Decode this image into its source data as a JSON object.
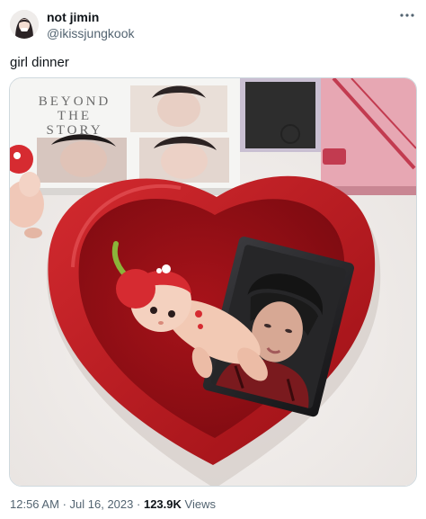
{
  "author": {
    "display_name": "not jimin",
    "handle": "@ikissjungkook"
  },
  "tweet": {
    "text": "girl dinner"
  },
  "photo": {
    "book_title_line1": "BEYOND",
    "book_title_line2": "THE",
    "book_title_line3": "STORY",
    "colors": {
      "bowl": "#b3151c",
      "bowl_inner": "#8f0c12",
      "background": "#f1eeec",
      "pink_box": "#e7a7b3"
    }
  },
  "meta": {
    "time": "12:56 AM",
    "separator1": "·",
    "date": "Jul 16, 2023",
    "separator2": "·",
    "views_count": "123.9K",
    "views_label": "Views"
  },
  "icons": {
    "more": "more-horizontal-icon"
  }
}
